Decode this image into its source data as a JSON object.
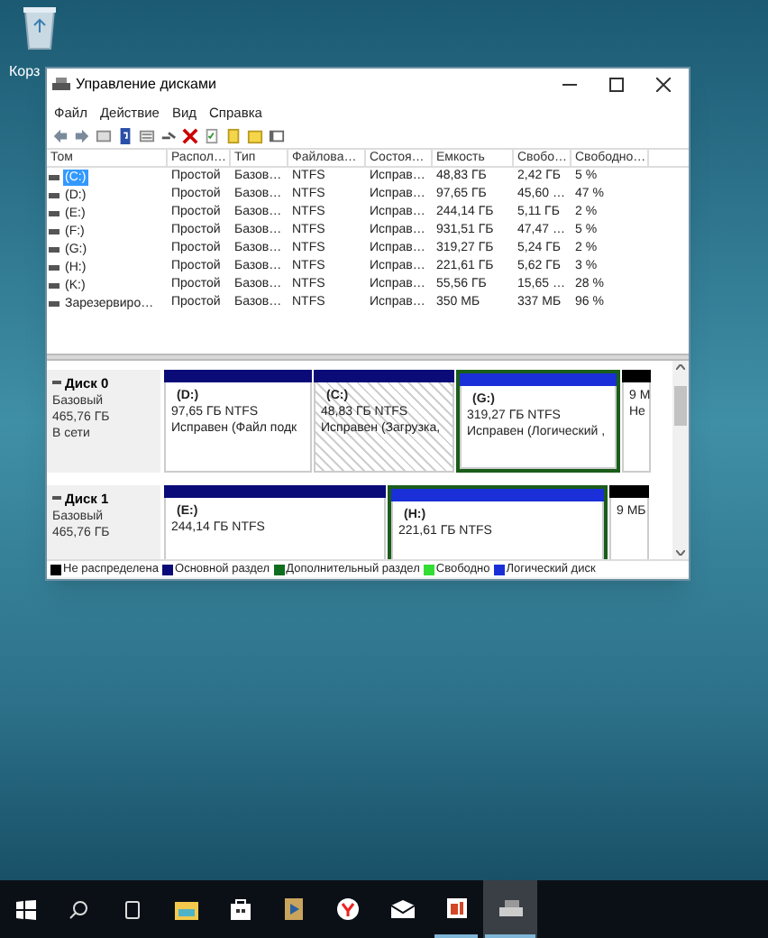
{
  "desktop_icons": [
    {
      "label": "Корз"
    }
  ],
  "window": {
    "title": "Управление дисками"
  },
  "menu": [
    "Файл",
    "Действие",
    "Вид",
    "Справка"
  ],
  "table": {
    "columns": [
      "Том",
      "Распол…",
      "Тип",
      "Файлова…",
      "Состоя…",
      "Емкость",
      "Свобо…",
      "Свободно…"
    ],
    "rows": [
      {
        "selected": true,
        "cells": [
          "(C:)",
          "Простой",
          "Базов…",
          "NTFS",
          "Исправ…",
          "48,83 ГБ",
          "2,42 ГБ",
          "5 %"
        ]
      },
      {
        "selected": false,
        "cells": [
          "(D:)",
          "Простой",
          "Базов…",
          "NTFS",
          "Исправ…",
          "97,65 ГБ",
          "45,60 …",
          "47 %"
        ]
      },
      {
        "selected": false,
        "cells": [
          "(E:)",
          "Простой",
          "Базов…",
          "NTFS",
          "Исправ…",
          "244,14 ГБ",
          "5,11 ГБ",
          "2 %"
        ]
      },
      {
        "selected": false,
        "cells": [
          "(F:)",
          "Простой",
          "Базов…",
          "NTFS",
          "Исправ…",
          "931,51 ГБ",
          "47,47 …",
          "5 %"
        ]
      },
      {
        "selected": false,
        "cells": [
          "(G:)",
          "Простой",
          "Базов…",
          "NTFS",
          "Исправ…",
          "319,27 ГБ",
          "5,24 ГБ",
          "2 %"
        ]
      },
      {
        "selected": false,
        "cells": [
          "(H:)",
          "Простой",
          "Базов…",
          "NTFS",
          "Исправ…",
          "221,61 ГБ",
          "5,62 ГБ",
          "3 %"
        ]
      },
      {
        "selected": false,
        "cells": [
          "(K:)",
          "Простой",
          "Базов…",
          "NTFS",
          "Исправ…",
          "55,56 ГБ",
          "15,65 …",
          "28 %"
        ]
      },
      {
        "selected": false,
        "cells": [
          "Зарезервиро…",
          "Простой",
          "Базов…",
          "NTFS",
          "Исправ…",
          "350 МБ",
          "337 МБ",
          "96 %"
        ]
      }
    ]
  },
  "disks": [
    {
      "name": "Диск 0",
      "info": [
        "Базовый",
        "465,76 ГБ",
        "В сети"
      ],
      "partitions": [
        {
          "kind": "primary",
          "selected": false,
          "lines": [
            "(D:)",
            "97,65 ГБ NTFS",
            "Исправен (Файл подк"
          ]
        },
        {
          "kind": "primary",
          "selected": true,
          "lines": [
            "(C:)",
            "48,83 ГБ NTFS",
            "Исправен (Загрузка,"
          ]
        },
        {
          "kind": "logical",
          "selected": false,
          "lines": [
            "(G:)",
            "319,27 ГБ NTFS",
            "Исправен (Логический ,"
          ]
        },
        {
          "kind": "unallocated",
          "selected": false,
          "lines": [
            "9 M",
            "Не"
          ]
        }
      ]
    },
    {
      "name": "Диск 1",
      "info": [
        "Базовый",
        "465,76 ГБ"
      ],
      "partitions": [
        {
          "kind": "primary",
          "selected": false,
          "lines": [
            "(E:)",
            "244,14 ГБ NTFS"
          ]
        },
        {
          "kind": "logical",
          "selected": false,
          "lines": [
            "(H:)",
            "221,61 ГБ NTFS"
          ]
        },
        {
          "kind": "unallocated",
          "selected": false,
          "lines": [
            "9 МБ"
          ]
        }
      ]
    }
  ],
  "legend": [
    {
      "label": "Не распределена",
      "color": "#000000"
    },
    {
      "label": "Основной раздел",
      "color": "#0a0a78"
    },
    {
      "label": "Дополнительный раздел",
      "color": "#0f6e1e"
    },
    {
      "label": "Свободно",
      "color": "#33dd33"
    },
    {
      "label": "Логический диск",
      "color": "#1a2fd8"
    }
  ]
}
